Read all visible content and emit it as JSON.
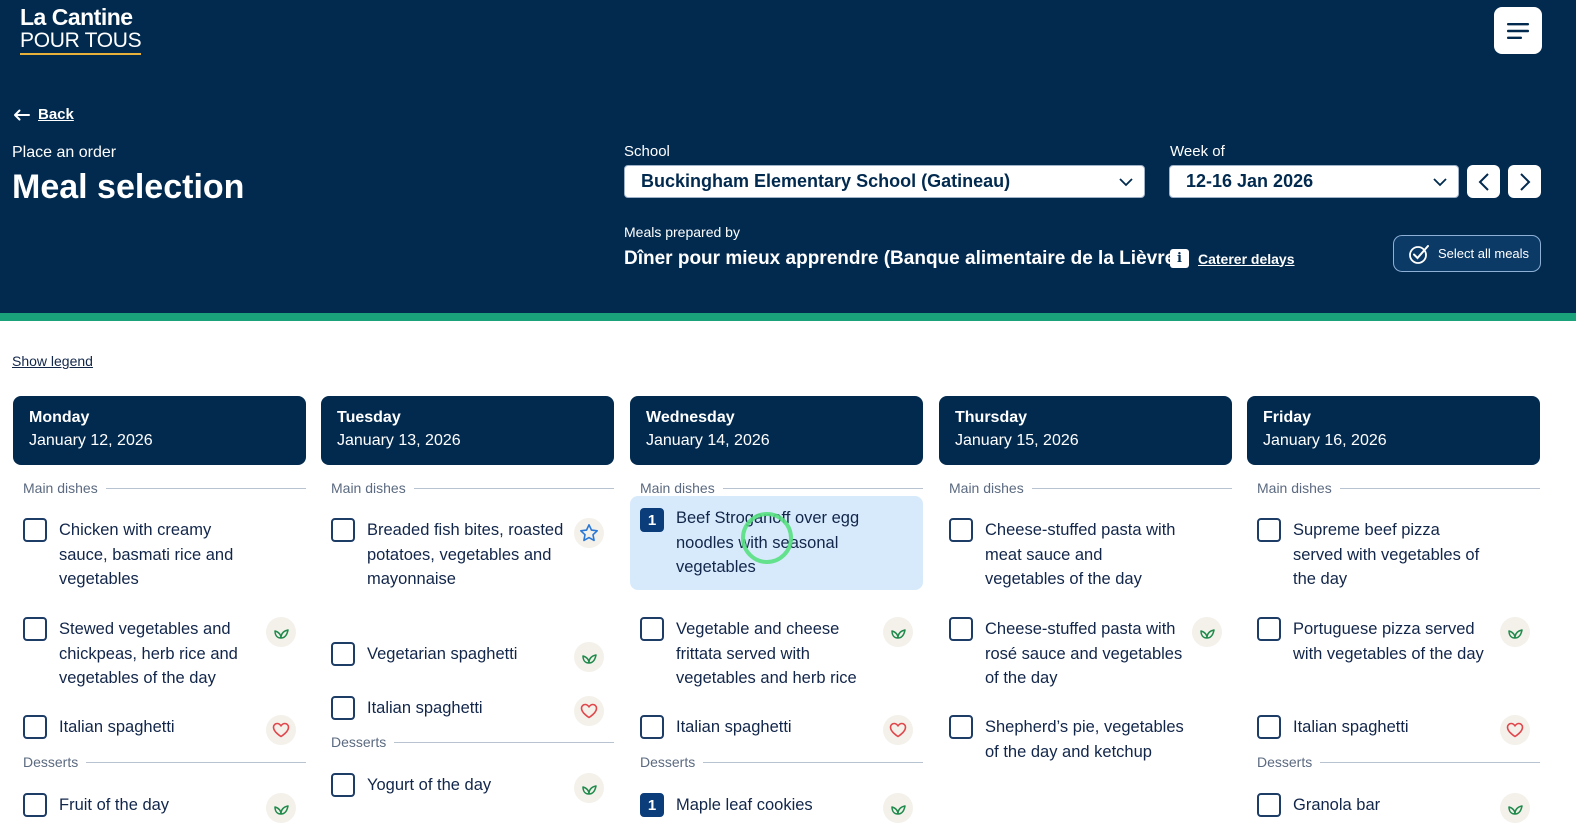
{
  "app": {
    "logo_line1": "La Cantine",
    "logo_line2": "POUR TOUS"
  },
  "nav": {
    "back_label": "Back"
  },
  "page": {
    "eyebrow": "Place an order",
    "title": "Meal selection"
  },
  "filters": {
    "school_label": "School",
    "school_value": "Buckingham Elementary School (Gatineau)",
    "week_label": "Week of",
    "week_value": "12-16 Jan 2026"
  },
  "caterer": {
    "label": "Meals prepared by",
    "value": "Dîner pour mieux apprendre (Banque alimentaire de la Lièvre)",
    "delays_label": "Caterer delays",
    "select_all_label": "Select all meals"
  },
  "legend_label": "Show legend",
  "colors": {
    "header_bg": "#022a4f",
    "accent_green": "#1aa37a",
    "selected_bg": "#d7eafc",
    "vegetarian_icon": "#1f8a4c",
    "favorite_icon": "#e0474c",
    "star_icon": "#2a78d6"
  },
  "days": [
    {
      "name": "Monday",
      "date": "January 12, 2026",
      "main_label": "Main dishes",
      "mains": [
        {
          "text": "Chicken with creamy sauce, basmati rice and vegetables",
          "icon": "",
          "qty": ""
        },
        {
          "text": "Stewed vegetables and chickpeas, herb rice and vegetables of the day",
          "icon": "leaf-icon",
          "qty": ""
        },
        {
          "text": "Italian spaghetti",
          "icon": "heart-icon",
          "qty": ""
        }
      ],
      "dessert_label": "Desserts",
      "desserts": [
        {
          "text": "Fruit of the day",
          "icon": "leaf-icon",
          "qty": ""
        }
      ]
    },
    {
      "name": "Tuesday",
      "date": "January 13, 2026",
      "main_label": "Main dishes",
      "mains": [
        {
          "text": "Breaded fish bites, roasted potatoes, vegetables and mayonnaise",
          "icon": "star-icon",
          "qty": ""
        },
        {
          "text": "Vegetarian spaghetti",
          "icon": "leaf-icon",
          "qty": ""
        },
        {
          "text": "Italian spaghetti",
          "icon": "heart-icon",
          "qty": ""
        }
      ],
      "dessert_label": "Desserts",
      "desserts": [
        {
          "text": "Yogurt of the day",
          "icon": "leaf-icon",
          "qty": ""
        }
      ]
    },
    {
      "name": "Wednesday",
      "date": "January 14, 2026",
      "main_label": "Main dishes",
      "mains": [
        {
          "text": "Beef Stroganoff over egg noodles with seasonal vegetables",
          "icon": "",
          "qty": "1"
        },
        {
          "text": "Vegetable and cheese frittata served with vegetables and herb rice",
          "icon": "leaf-icon",
          "qty": ""
        },
        {
          "text": "Italian spaghetti",
          "icon": "heart-icon",
          "qty": ""
        }
      ],
      "dessert_label": "Desserts",
      "desserts": [
        {
          "text": "Maple leaf cookies",
          "icon": "leaf-icon",
          "qty": "1"
        }
      ]
    },
    {
      "name": "Thursday",
      "date": "January 15, 2026",
      "main_label": "Main dishes",
      "mains": [
        {
          "text": "Cheese-stuffed pasta with meat sauce and vegetables of the day",
          "icon": "",
          "qty": ""
        },
        {
          "text": "Cheese-stuffed pasta with rosé sauce and vegetables of the day",
          "icon": "leaf-icon",
          "qty": ""
        },
        {
          "text": "Shepherd’s pie, vegetables of the day and ketchup",
          "icon": "",
          "qty": ""
        }
      ],
      "dessert_label": "",
      "desserts": []
    },
    {
      "name": "Friday",
      "date": "January 16, 2026",
      "main_label": "Main dishes",
      "mains": [
        {
          "text": "Supreme beef pizza served with vegetables of the day",
          "icon": "",
          "qty": ""
        },
        {
          "text": "Portuguese pizza served with vegetables of the day",
          "icon": "leaf-icon",
          "qty": ""
        },
        {
          "text": "Italian spaghetti",
          "icon": "heart-icon",
          "qty": ""
        }
      ],
      "dessert_label": "Desserts",
      "desserts": [
        {
          "text": "Granola bar",
          "icon": "leaf-icon",
          "qty": ""
        }
      ]
    }
  ]
}
